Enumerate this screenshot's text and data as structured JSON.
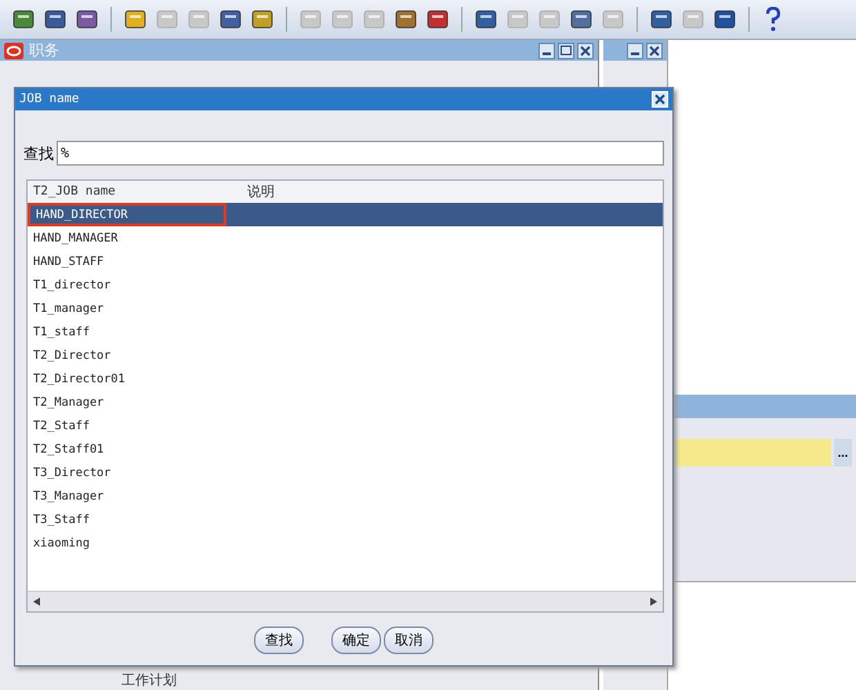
{
  "toolbar": [
    {
      "kind": "icon",
      "disabled": false
    },
    {
      "kind": "icon",
      "disabled": false
    },
    {
      "kind": "icon",
      "disabled": false
    },
    {
      "kind": "separator"
    },
    {
      "kind": "icon",
      "disabled": false
    },
    {
      "kind": "icon",
      "disabled": true
    },
    {
      "kind": "icon",
      "disabled": true
    },
    {
      "kind": "icon",
      "disabled": false
    },
    {
      "kind": "icon",
      "disabled": false
    },
    {
      "kind": "separator"
    },
    {
      "kind": "icon",
      "disabled": true
    },
    {
      "kind": "icon",
      "disabled": true
    },
    {
      "kind": "icon",
      "disabled": true
    },
    {
      "kind": "icon",
      "disabled": false
    },
    {
      "kind": "icon",
      "disabled": false
    },
    {
      "kind": "separator"
    },
    {
      "kind": "icon",
      "disabled": false
    },
    {
      "kind": "icon",
      "disabled": true
    },
    {
      "kind": "icon",
      "disabled": true
    },
    {
      "kind": "icon",
      "disabled": false
    },
    {
      "kind": "icon",
      "disabled": true
    },
    {
      "kind": "separator"
    },
    {
      "kind": "icon",
      "disabled": false
    },
    {
      "kind": "icon",
      "disabled": true
    },
    {
      "kind": "icon",
      "disabled": false
    },
    {
      "kind": "separator"
    },
    {
      "kind": "icon",
      "disabled": false
    }
  ],
  "main_window": {
    "title": "职务",
    "bottom_text": "工作计划"
  },
  "dialog": {
    "title": "JOB name",
    "search_label": "查找",
    "search_value": "%",
    "columns": [
      "T2_JOB name",
      "说明"
    ],
    "rows": [
      {
        "name": "HAND_DIRECTOR",
        "selected": true
      },
      {
        "name": "HAND_MANAGER",
        "selected": false
      },
      {
        "name": "HAND_STAFF",
        "selected": false
      },
      {
        "name": "T1_director",
        "selected": false
      },
      {
        "name": "T1_manager",
        "selected": false
      },
      {
        "name": "T1_staff",
        "selected": false
      },
      {
        "name": "T2_Director",
        "selected": false
      },
      {
        "name": "T2_Director01",
        "selected": false
      },
      {
        "name": "T2_Manager",
        "selected": false
      },
      {
        "name": "T2_Staff",
        "selected": false
      },
      {
        "name": "T2_Staff01",
        "selected": false
      },
      {
        "name": "T3_Director",
        "selected": false
      },
      {
        "name": "T3_Manager",
        "selected": false
      },
      {
        "name": "T3_Staff",
        "selected": false
      },
      {
        "name": "xiaoming",
        "selected": false
      }
    ],
    "buttons": [
      "查找",
      "确定",
      "取消"
    ]
  },
  "side_field": {
    "button": "..."
  }
}
